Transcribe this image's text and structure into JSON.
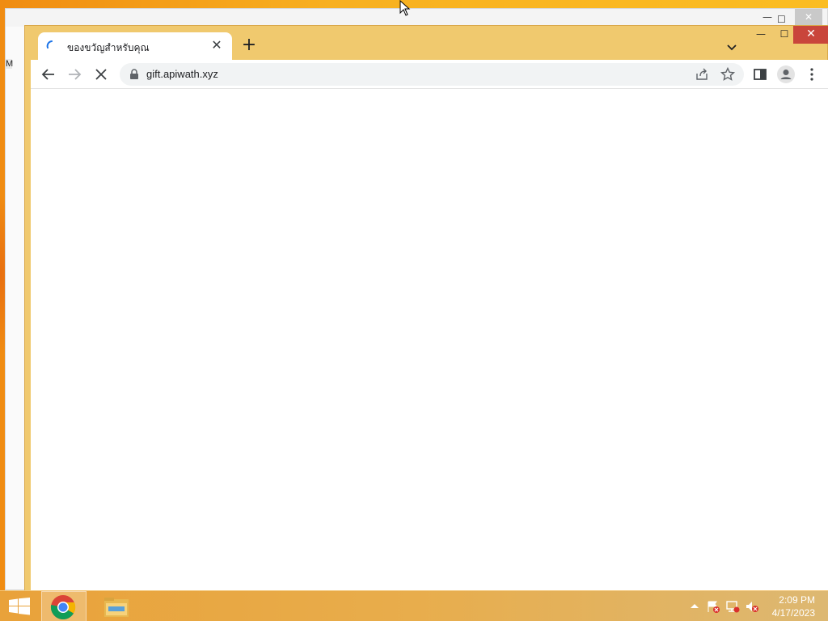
{
  "browser": {
    "tab": {
      "title": "ของขวัญสำหรับคุณ",
      "close_glyph": "✕",
      "status": "loading"
    },
    "new_tab_glyph": "+",
    "window_controls": {
      "minimize": "—",
      "maximize": "☐",
      "close": "✕"
    },
    "toolbar": {
      "url": "gift.apiwath.xyz"
    }
  },
  "background_window": {
    "side_letter": "M",
    "controls": {
      "minimize": "—",
      "maximize": "☐",
      "close": "✕"
    }
  },
  "taskbar": {
    "apps": [
      "chrome-icon",
      "file-explorer-icon"
    ],
    "tray_icons": [
      "show-hidden-icons-arrow",
      "action-center-flag-icon",
      "network-icon",
      "volume-muted-icon"
    ],
    "clock": {
      "time": "2:09 PM",
      "date": "4/17/2023"
    }
  },
  "colors": {
    "desktop": "#f8b020",
    "chrome_frame": "#f0c96e",
    "close_button": "#c9453b"
  }
}
